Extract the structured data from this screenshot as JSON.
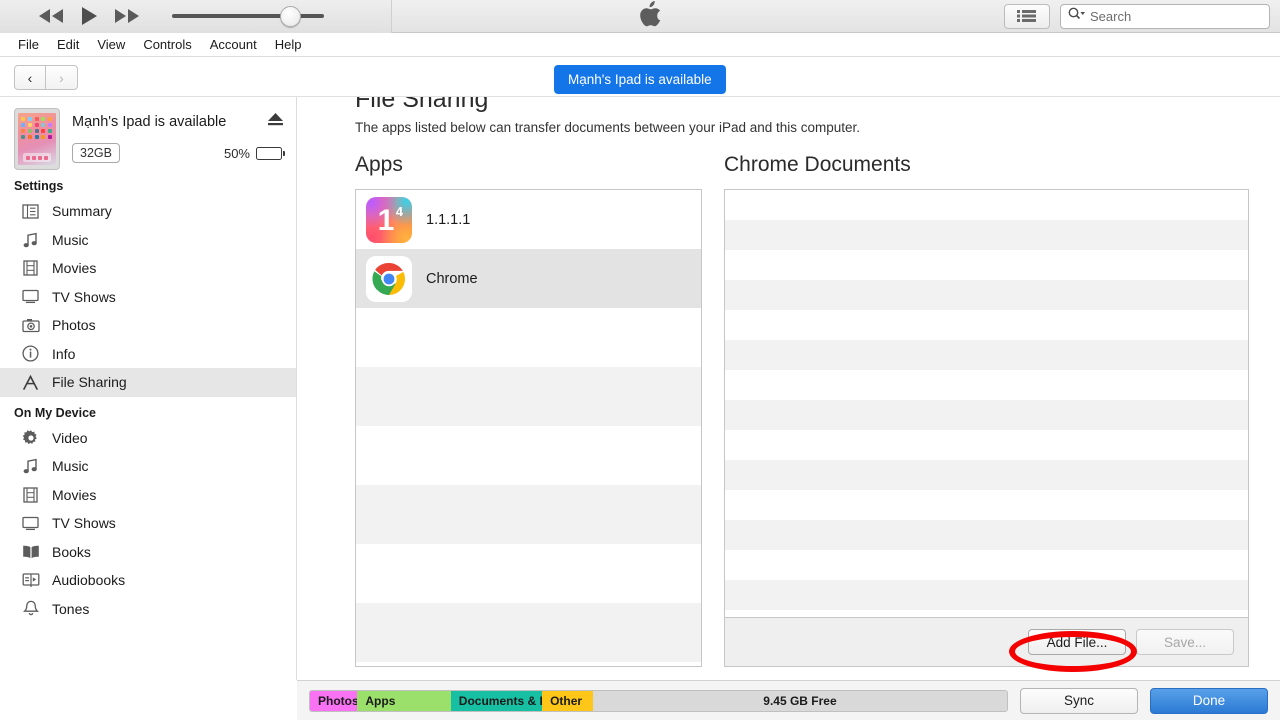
{
  "toolbar": {
    "rewind_icon": "rewind-icon",
    "play_icon": "play-icon",
    "forward_icon": "fast-forward-icon",
    "apple_icon": "apple-logo-icon",
    "list_icon": "list-view-icon",
    "search_icon": "search-icon",
    "search_placeholder": "Search",
    "search_value": "",
    "volume_percent": 78
  },
  "menubar": {
    "items": [
      {
        "label": "File"
      },
      {
        "label": "Edit"
      },
      {
        "label": "View"
      },
      {
        "label": "Controls"
      },
      {
        "label": "Account"
      },
      {
        "label": "Help"
      }
    ]
  },
  "nav": {
    "back_label": "‹",
    "forward_label": "›"
  },
  "banner": {
    "text": "Mạnh's Ipad is available"
  },
  "device": {
    "name": "Mạnh's Ipad is available",
    "capacity": "32GB",
    "battery_percent": "50%",
    "battery_level": 50,
    "eject_icon": "eject-icon"
  },
  "sidebar": {
    "settings_title": "Settings",
    "settings_items": [
      {
        "label": "Summary",
        "icon": "summary-icon",
        "selected": false
      },
      {
        "label": "Music",
        "icon": "music-note-icon",
        "selected": false
      },
      {
        "label": "Movies",
        "icon": "film-icon",
        "selected": false
      },
      {
        "label": "TV Shows",
        "icon": "tv-icon",
        "selected": false
      },
      {
        "label": "Photos",
        "icon": "camera-icon",
        "selected": false
      },
      {
        "label": "Info",
        "icon": "info-circle-icon",
        "selected": false
      },
      {
        "label": "File Sharing",
        "icon": "app-store-a-icon",
        "selected": true
      }
    ],
    "device_title": "On My Device",
    "device_items": [
      {
        "label": "Video",
        "icon": "gear-icon"
      },
      {
        "label": "Music",
        "icon": "music-note-icon"
      },
      {
        "label": "Movies",
        "icon": "film-icon"
      },
      {
        "label": "TV Shows",
        "icon": "tv-icon"
      },
      {
        "label": "Books",
        "icon": "book-icon"
      },
      {
        "label": "Audiobooks",
        "icon": "audiobook-icon"
      },
      {
        "label": "Tones",
        "icon": "bell-icon"
      }
    ]
  },
  "main": {
    "title": "File Sharing",
    "description": "The apps listed below can transfer documents between your iPad and this computer.",
    "apps_header": "Apps",
    "documents_header": "Chrome Documents",
    "apps": [
      {
        "name": "1.1.1.1",
        "icon": "app-icon-1111",
        "selected": false
      },
      {
        "name": "Chrome",
        "icon": "app-icon-chrome",
        "selected": true
      }
    ],
    "documents": [],
    "document_rows_empty": 16,
    "add_file_label": "Add File...",
    "save_label": "Save...",
    "save_disabled": true
  },
  "capacity_bar": {
    "segments": [
      {
        "label": "Photos",
        "color": "#f972f3",
        "width_pct": 6.8
      },
      {
        "label": "Apps",
        "color": "#9ae06a",
        "width_pct": 13.4
      },
      {
        "label": "Documents & Data",
        "color": "#17bfa3",
        "width_pct": 13.1
      },
      {
        "label": "Other",
        "color": "#ffc61a",
        "width_pct": 7.3
      },
      {
        "label": "9.45 GB Free",
        "color": "#d9d9d9",
        "width_pct": 59.4
      }
    ]
  },
  "footer": {
    "sync_label": "Sync",
    "done_label": "Done"
  }
}
